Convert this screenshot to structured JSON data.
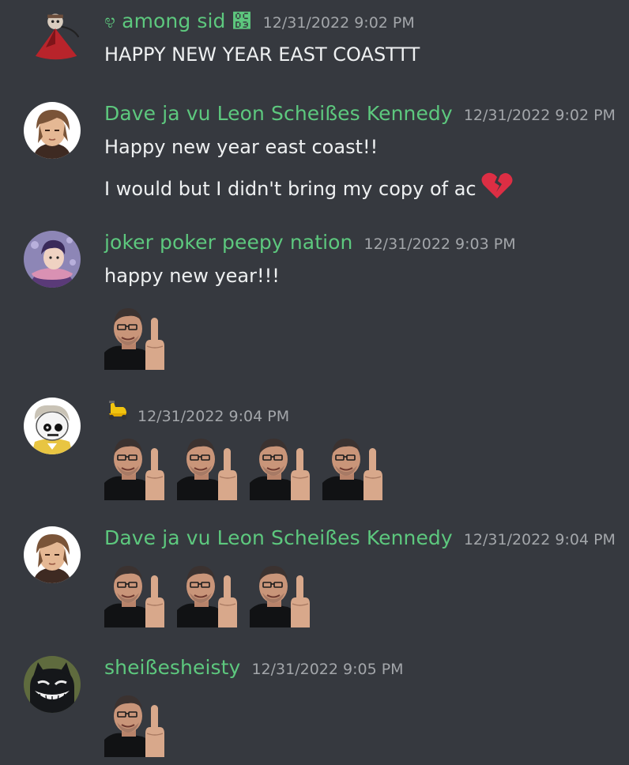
{
  "messages": [
    {
      "username": "೪ among sid ೓",
      "timestamp": "12/31/2022 9:02 PM",
      "lines": [
        "HAPPY NEW YEAR EAST COASTTT"
      ]
    },
    {
      "username": "Dave ja vu Leon Scheißes Kennedy",
      "timestamp": "12/31/2022 9:02 PM",
      "lines": [
        "Happy new year east coast!!",
        "I would but I didn't bring my copy of ac"
      ]
    },
    {
      "username": "joker poker peepy nation",
      "timestamp": "12/31/2022 9:03 PM",
      "lines": [
        "happy new year!!!"
      ],
      "emoji_count": 1
    },
    {
      "username": "",
      "timestamp": "12/31/2022 9:04 PM",
      "emoji_count": 4
    },
    {
      "username": "Dave ja vu Leon Scheißes Kennedy",
      "timestamp": "12/31/2022 9:04 PM",
      "emoji_count": 3
    },
    {
      "username": "sheißesheisty",
      "timestamp": "12/31/2022 9:05 PM",
      "emoji_count": 1
    }
  ],
  "icons": {
    "broken_heart": "broken-heart-icon",
    "scooter": "scooter-icon",
    "custom_emoji": "middle-finger-face-emoji"
  },
  "colors": {
    "background": "#36393f",
    "username": "#5dc87e",
    "timestamp": "#a3a6aa",
    "text": "#eef0f1"
  }
}
